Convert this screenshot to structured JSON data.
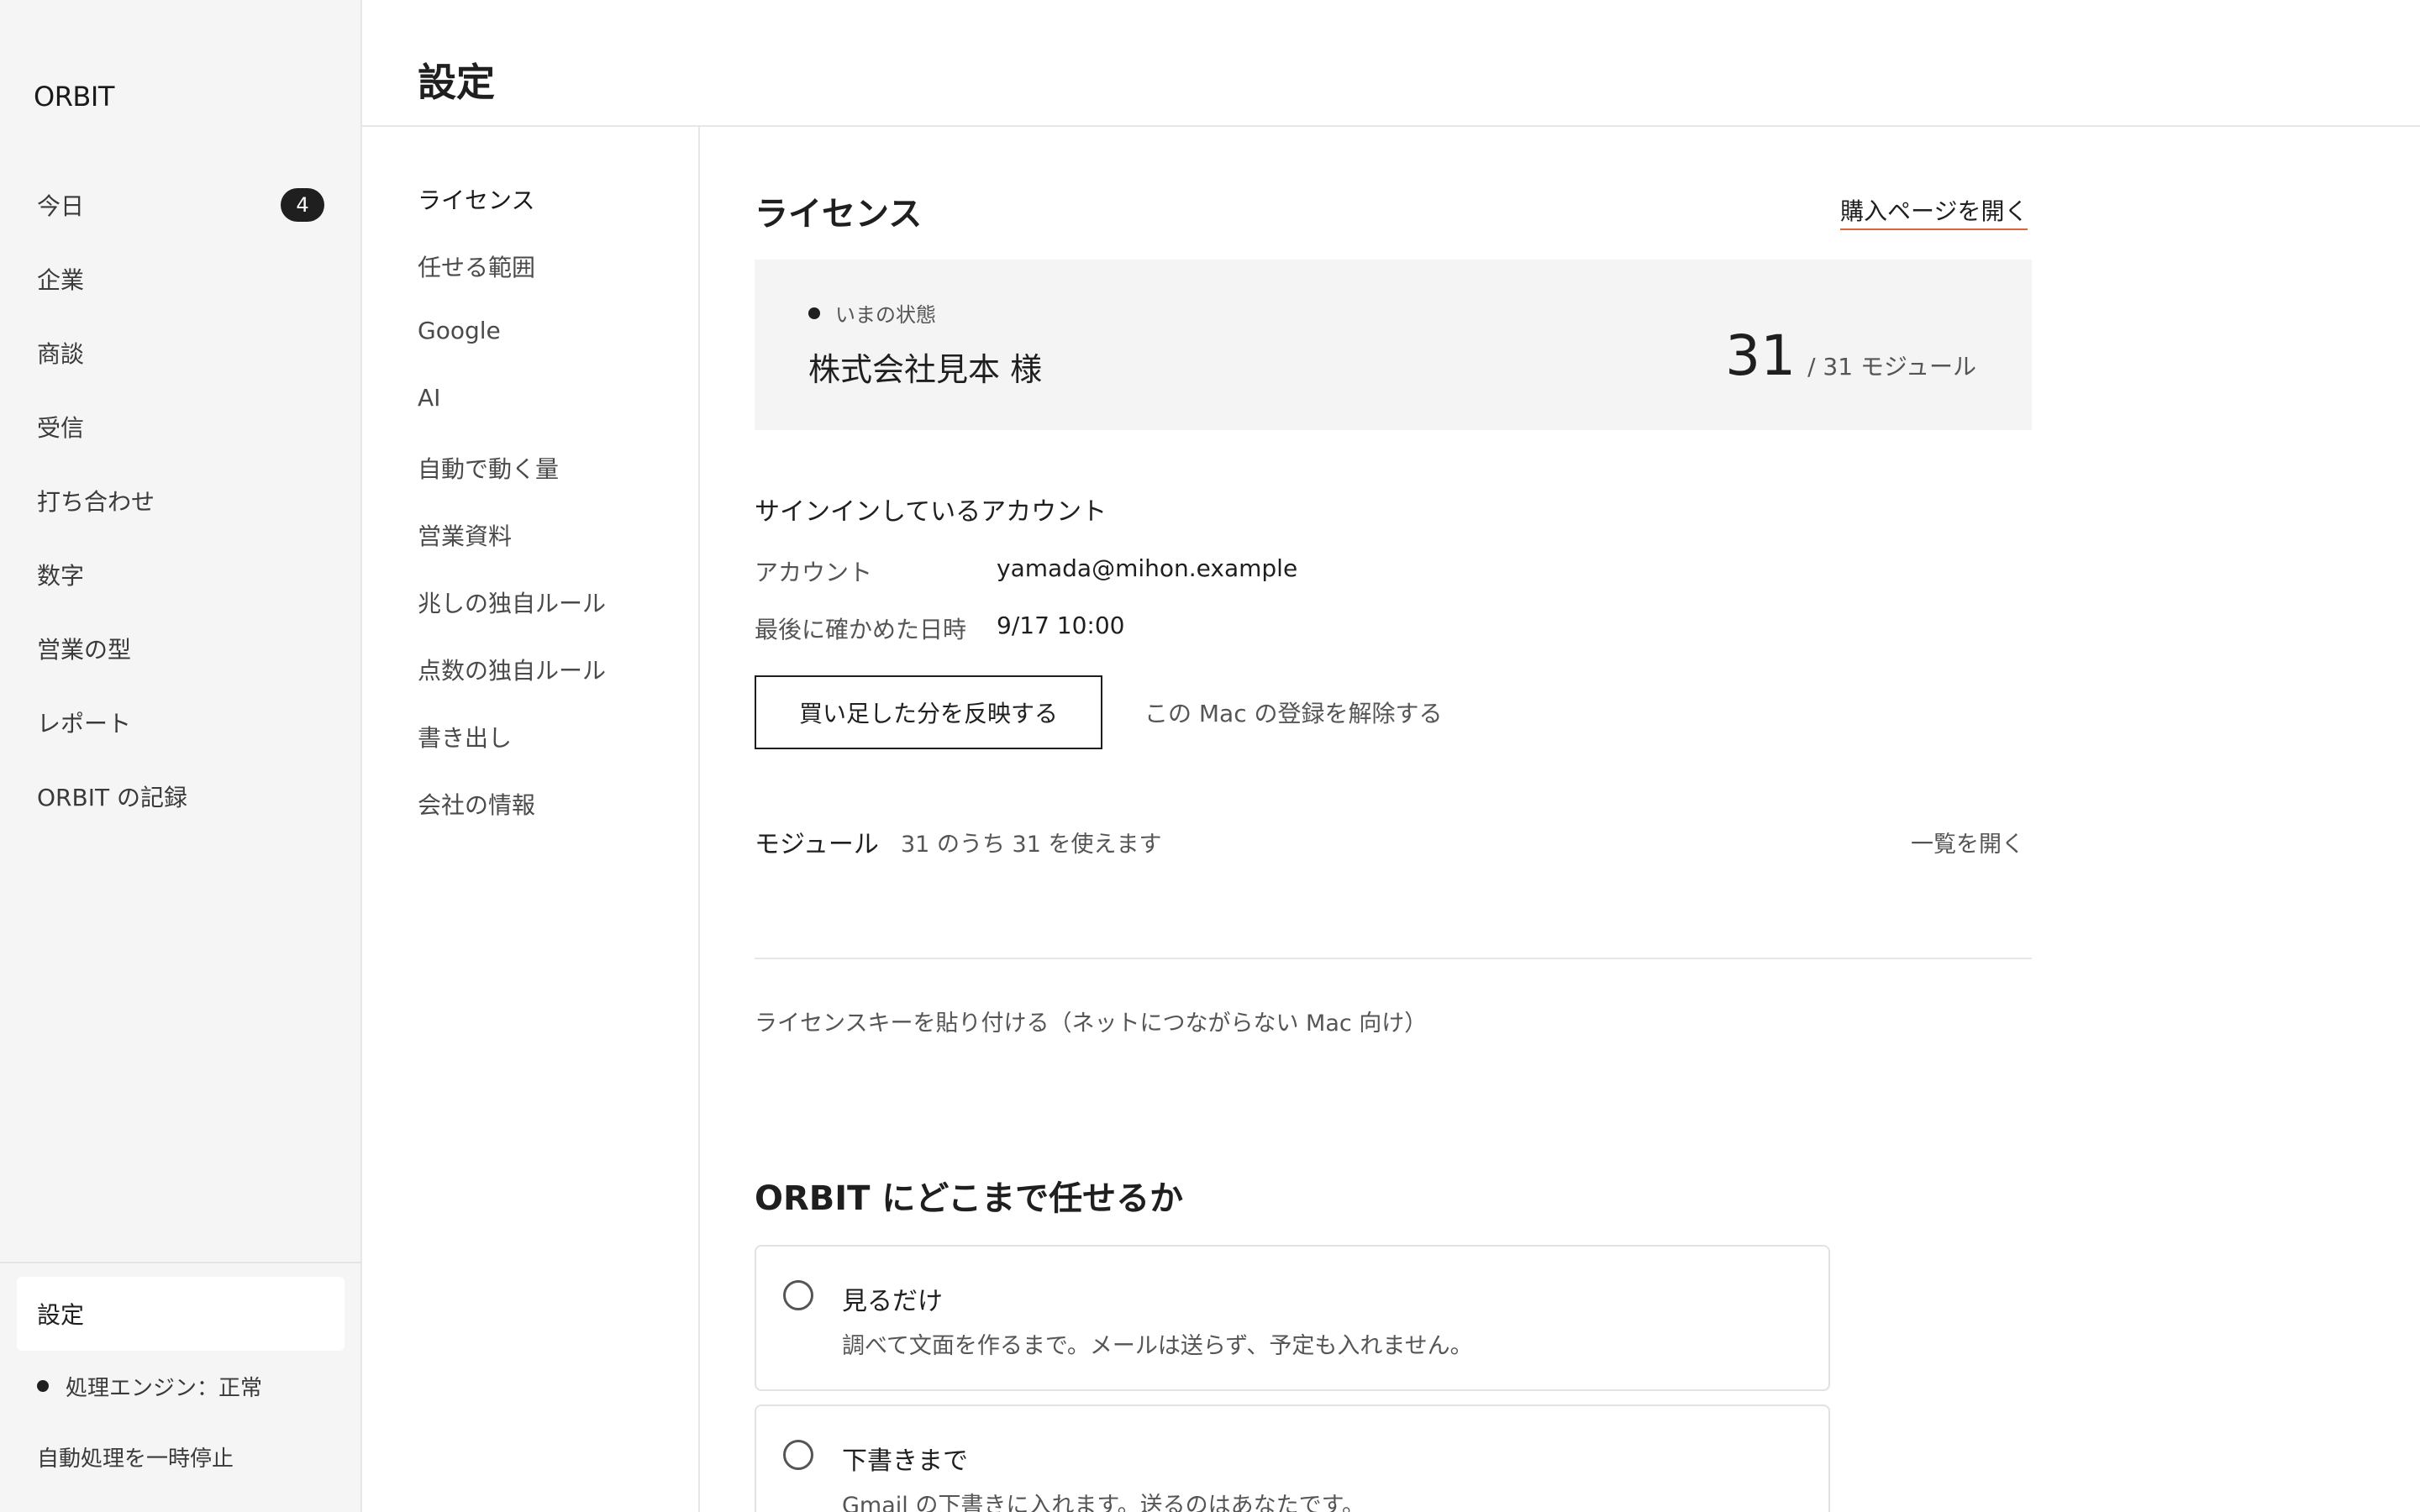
{
  "sidebar": {
    "logo": "ORBIT",
    "items": [
      {
        "label": "今日",
        "badge": "4"
      },
      {
        "label": "企業"
      },
      {
        "label": "商談"
      },
      {
        "label": "受信"
      },
      {
        "label": "打ち合わせ"
      },
      {
        "label": "数字"
      },
      {
        "label": "営業の型"
      },
      {
        "label": "レポート"
      },
      {
        "label": "ORBIT の記録"
      }
    ],
    "settings_label": "設定",
    "engine_status": "処理エンジン：正常",
    "pause_label": "自動処理を一時停止"
  },
  "header": {
    "title": "設定"
  },
  "subnav": {
    "items": [
      {
        "label": "ライセンス"
      },
      {
        "label": "任せる範囲"
      },
      {
        "label": "Google"
      },
      {
        "label": "AI"
      },
      {
        "label": "自動で動く量"
      },
      {
        "label": "営業資料"
      },
      {
        "label": "兆しの独自ルール"
      },
      {
        "label": "点数の独自ルール"
      },
      {
        "label": "書き出し"
      },
      {
        "label": "会社の情報"
      }
    ]
  },
  "license": {
    "title": "ライセンス",
    "buy_link": "購入ページを開く",
    "status_label": "いまの状態",
    "company": "株式会社見本 様",
    "module_count": "31",
    "module_total": "/ 31 モジュール",
    "account_heading": "サインインしているアカウント",
    "account_label": "アカウント",
    "account_value": "yamada@mihon.example",
    "checked_label": "最後に確かめた日時",
    "checked_value": "9/17 10:00",
    "reflect_button": "買い足した分を反映する",
    "unregister_link": "この Mac の登録を解除する",
    "modules_heading": "モジュール",
    "modules_desc": "31 のうち 31 を使えます",
    "open_list": "一覧を開く",
    "license_key_link": "ライセンスキーを貼り付ける（ネットにつながらない Mac 向け）"
  },
  "delegation": {
    "title": "ORBIT にどこまで任せるか",
    "options": [
      {
        "title": "見るだけ",
        "desc": "調べて文面を作るまで。メールは送らず、予定も入れません。"
      },
      {
        "title": "下書きまで",
        "desc": "Gmail の下書きに入れます。送るのはあなたです。"
      }
    ]
  }
}
